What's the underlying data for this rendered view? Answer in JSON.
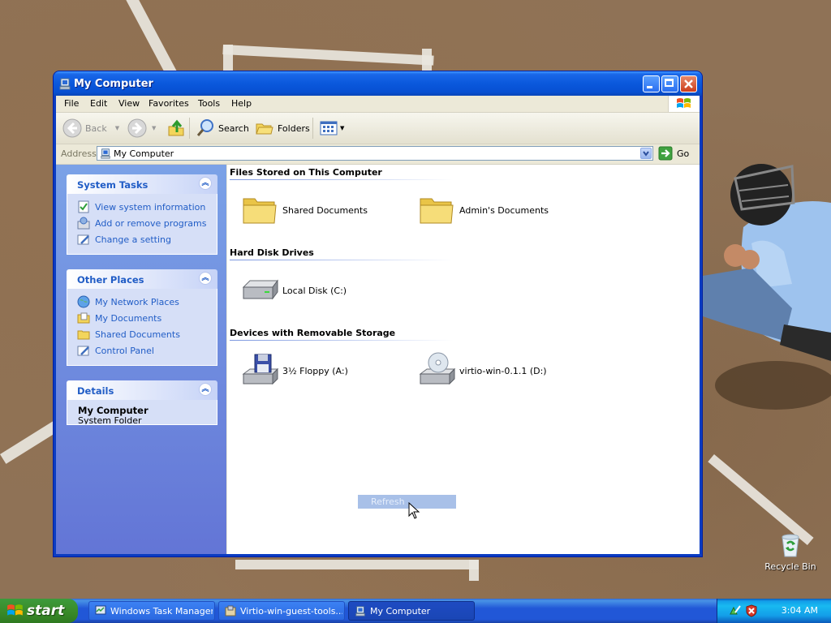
{
  "window": {
    "title": "My Computer",
    "menu": [
      "File",
      "Edit",
      "View",
      "Favorites",
      "Tools",
      "Help"
    ],
    "toolbar": {
      "back": "Back",
      "search": "Search",
      "folders": "Folders"
    },
    "address": {
      "label": "Address",
      "value": "My Computer",
      "go": "Go"
    }
  },
  "taskpane": {
    "system_tasks": {
      "title": "System Tasks",
      "items": [
        "View system information",
        "Add or remove programs",
        "Change a setting"
      ]
    },
    "other_places": {
      "title": "Other Places",
      "items": [
        "My Network Places",
        "My Documents",
        "Shared Documents",
        "Control Panel"
      ]
    },
    "details": {
      "title": "Details",
      "name": "My Computer",
      "type": "System Folder"
    }
  },
  "content": {
    "files_section": "Files Stored on This Computer",
    "files": [
      "Shared Documents",
      "Admin's Documents"
    ],
    "hdd_section": "Hard Disk Drives",
    "hdd": [
      "Local Disk (C:)"
    ],
    "removable_section": "Devices with Removable Storage",
    "removable": [
      "3½ Floppy (A:)",
      "virtio-win-0.1.1 (D:)"
    ],
    "tooltip": "Refresh"
  },
  "desktop": {
    "recycle_bin": "Recycle Bin"
  },
  "taskbar": {
    "start": "start",
    "tasks": [
      "Windows Task Manager",
      "Virtio-win-guest-tools...",
      "My Computer"
    ],
    "clock": "3:04 AM"
  }
}
